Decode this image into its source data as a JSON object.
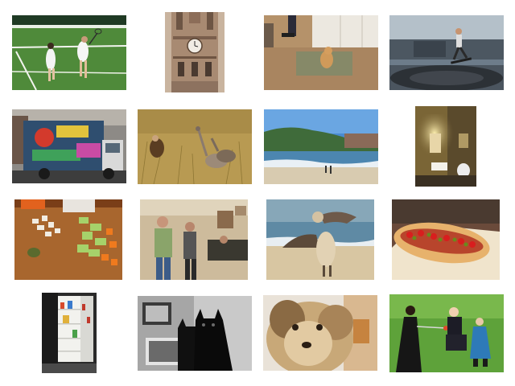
{
  "gallery": {
    "thumbnails": [
      {
        "name": "tennis-doubles-photo"
      },
      {
        "name": "clock-tower-photo"
      },
      {
        "name": "kitchen-cat-photo"
      },
      {
        "name": "skateboard-trick-photo"
      },
      {
        "name": "graffiti-truck-photo"
      },
      {
        "name": "vultures-in-grass-photo"
      },
      {
        "name": "beach-coast-photo"
      },
      {
        "name": "lit-bathroom-photo"
      },
      {
        "name": "chopped-vegetables-photo"
      },
      {
        "name": "wii-players-photo"
      },
      {
        "name": "pelican-beach-photo"
      },
      {
        "name": "hot-dog-photo"
      },
      {
        "name": "open-refrigerator-photo"
      },
      {
        "name": "black-cats-photo"
      },
      {
        "name": "shaggy-dog-photo"
      },
      {
        "name": "costume-sword-play-photo"
      }
    ]
  }
}
